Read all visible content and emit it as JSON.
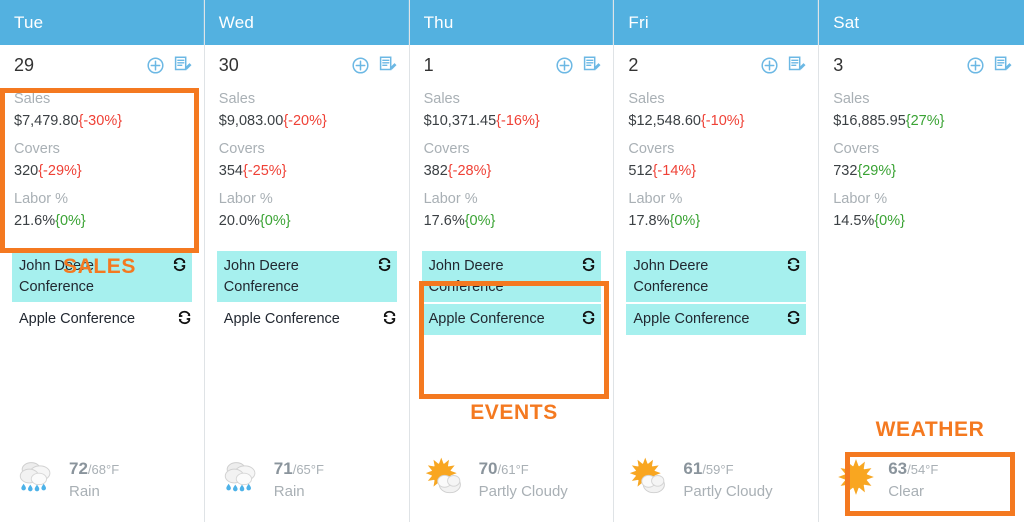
{
  "theme": {
    "header_bg": "#53b1e0",
    "event_bg": "#a6f0ee",
    "annotation": "#f47920",
    "negative": "#ef4136",
    "positive": "#3aa334",
    "muted": "#a9b0b5"
  },
  "metric_labels": {
    "sales": "Sales",
    "covers": "Covers",
    "labor": "Labor %"
  },
  "icons": {
    "add": "add-circle-icon",
    "note": "note-edit-icon",
    "sync": "sync-icon"
  },
  "annotations": [
    {
      "id": "sales",
      "label": "SALES"
    },
    {
      "id": "events",
      "label": "EVENTS"
    },
    {
      "id": "weather",
      "label": "WEATHER"
    }
  ],
  "days": [
    {
      "weekday": "Tue",
      "date": "29",
      "sales": {
        "value": "$7,479.80",
        "delta": "{-30%}",
        "dir": "neg"
      },
      "covers": {
        "value": "320",
        "delta": "{-29%}",
        "dir": "neg"
      },
      "labor": {
        "value": "21.6%",
        "delta": "{0%}",
        "dir": "pos"
      },
      "events": [
        {
          "title": "John Deere Conference",
          "highlighted": true
        },
        {
          "title": "Apple Conference",
          "highlighted": false
        }
      ],
      "weather": {
        "icon": "rain",
        "high": "72",
        "low": "/68°F",
        "condition": "Rain"
      }
    },
    {
      "weekday": "Wed",
      "date": "30",
      "sales": {
        "value": "$9,083.00",
        "delta": "{-20%}",
        "dir": "neg"
      },
      "covers": {
        "value": "354",
        "delta": "{-25%}",
        "dir": "neg"
      },
      "labor": {
        "value": "20.0%",
        "delta": "{0%}",
        "dir": "pos"
      },
      "events": [
        {
          "title": "John Deere Conference",
          "highlighted": true
        },
        {
          "title": "Apple Conference",
          "highlighted": false
        }
      ],
      "weather": {
        "icon": "rain",
        "high": "71",
        "low": "/65°F",
        "condition": "Rain"
      }
    },
    {
      "weekday": "Thu",
      "date": "1",
      "sales": {
        "value": "$10,371.45",
        "delta": "{-16%}",
        "dir": "neg"
      },
      "covers": {
        "value": "382",
        "delta": "{-28%}",
        "dir": "neg"
      },
      "labor": {
        "value": "17.6%",
        "delta": "{0%}",
        "dir": "pos"
      },
      "events": [
        {
          "title": "John Deere Conference",
          "highlighted": true
        },
        {
          "title": "Apple Conference",
          "highlighted": true
        }
      ],
      "weather": {
        "icon": "partly-cloudy",
        "high": "70",
        "low": "/61°F",
        "condition": "Partly Cloudy"
      }
    },
    {
      "weekday": "Fri",
      "date": "2",
      "sales": {
        "value": "$12,548.60",
        "delta": "{-10%}",
        "dir": "neg"
      },
      "covers": {
        "value": "512",
        "delta": "{-14%}",
        "dir": "neg"
      },
      "labor": {
        "value": "17.8%",
        "delta": "{0%}",
        "dir": "pos"
      },
      "events": [
        {
          "title": "John Deere Conference",
          "highlighted": true
        },
        {
          "title": "Apple Conference",
          "highlighted": true
        }
      ],
      "weather": {
        "icon": "partly-cloudy",
        "high": "61",
        "low": "/59°F",
        "condition": "Partly Cloudy"
      }
    },
    {
      "weekday": "Sat",
      "date": "3",
      "sales": {
        "value": "$16,885.95",
        "delta": "{27%}",
        "dir": "pos"
      },
      "covers": {
        "value": "732",
        "delta": "{29%}",
        "dir": "pos"
      },
      "labor": {
        "value": "14.5%",
        "delta": "{0%}",
        "dir": "pos"
      },
      "events": [],
      "weather": {
        "icon": "sunny",
        "high": "63",
        "low": "/54°F",
        "condition": "Clear"
      }
    }
  ]
}
